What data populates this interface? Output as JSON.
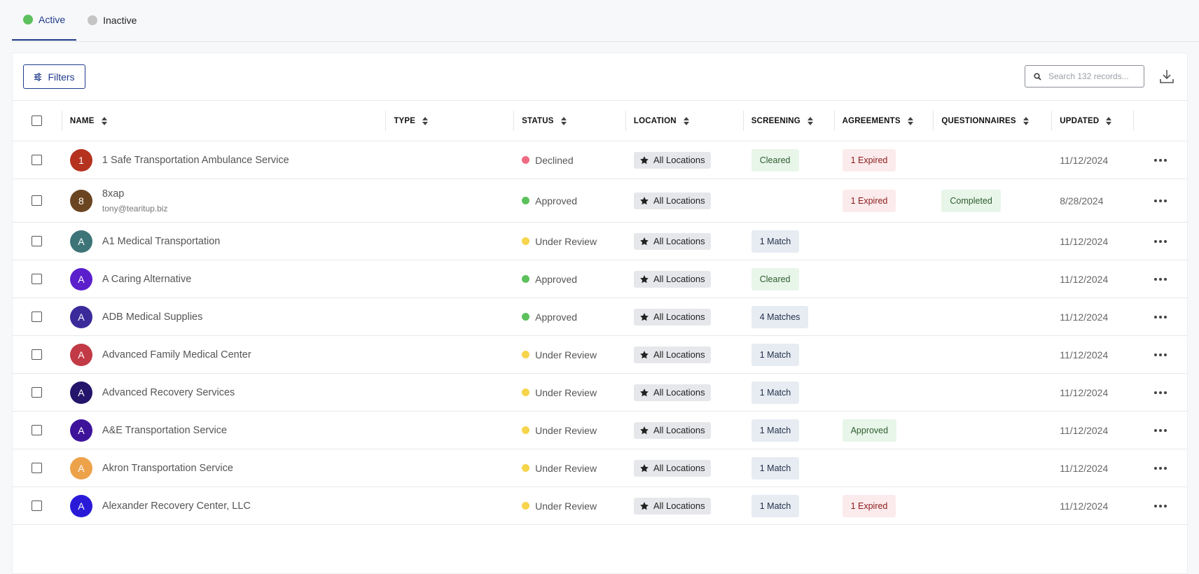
{
  "tabs": [
    {
      "label": "Active",
      "dot_color": "#5cc15c"
    },
    {
      "label": "Inactive",
      "dot_color": "#c4c4c4"
    }
  ],
  "toolbar": {
    "filters_label": "Filters",
    "search_placeholder": "Search 132 records..."
  },
  "columns": [
    "NAME",
    "TYPE",
    "STATUS",
    "LOCATION",
    "SCREENING",
    "AGREEMENTS",
    "QUESTIONNAIRES",
    "UPDATED"
  ],
  "status_colors": {
    "Declined": "#ef6b84",
    "Approved": "#5cc15c",
    "Under Review": "#f6d44c"
  },
  "rows": [
    {
      "initial": "1",
      "avatar_color": "#b5321f",
      "name": "1 Safe Transportation Ambulance Service",
      "email": "",
      "type": "",
      "status": "Declined",
      "location": "All Locations",
      "screening": "Cleared",
      "agreements": "1 Expired",
      "questionnaires": "",
      "updated": "11/12/2024"
    },
    {
      "initial": "8",
      "avatar_color": "#6b4522",
      "name": "8xap",
      "email": "tony@tearitup.biz",
      "type": "",
      "status": "Approved",
      "location": "All Locations",
      "screening": "",
      "agreements": "1 Expired",
      "questionnaires": "Completed",
      "updated": "8/28/2024"
    },
    {
      "initial": "A",
      "avatar_color": "#3d7478",
      "name": "A1 Medical Transportation",
      "email": "",
      "type": "",
      "status": "Under Review",
      "location": "All Locations",
      "screening": "1 Match",
      "agreements": "",
      "questionnaires": "",
      "updated": "11/12/2024"
    },
    {
      "initial": "A",
      "avatar_color": "#5b1fcc",
      "name": "A Caring Alternative",
      "email": "",
      "type": "",
      "status": "Approved",
      "location": "All Locations",
      "screening": "Cleared",
      "agreements": "",
      "questionnaires": "",
      "updated": "11/12/2024"
    },
    {
      "initial": "A",
      "avatar_color": "#3a2a9a",
      "name": "ADB Medical Supplies",
      "email": "",
      "type": "",
      "status": "Approved",
      "location": "All Locations",
      "screening": "4 Matches",
      "agreements": "",
      "questionnaires": "",
      "updated": "11/12/2024"
    },
    {
      "initial": "A",
      "avatar_color": "#c23a45",
      "name": "Advanced Family Medical Center",
      "email": "",
      "type": "",
      "status": "Under Review",
      "location": "All Locations",
      "screening": "1 Match",
      "agreements": "",
      "questionnaires": "",
      "updated": "11/12/2024"
    },
    {
      "initial": "A",
      "avatar_color": "#24146a",
      "name": "Advanced Recovery Services",
      "email": "",
      "type": "",
      "status": "Under Review",
      "location": "All Locations",
      "screening": "1 Match",
      "agreements": "",
      "questionnaires": "",
      "updated": "11/12/2024"
    },
    {
      "initial": "A",
      "avatar_color": "#3d139a",
      "name": "A&E Transportation Service",
      "email": "",
      "type": "",
      "status": "Under Review",
      "location": "All Locations",
      "screening": "1 Match",
      "agreements": "Approved",
      "questionnaires": "",
      "updated": "11/12/2024"
    },
    {
      "initial": "A",
      "avatar_color": "#eda24a",
      "name": "Akron Transportation Service",
      "email": "",
      "type": "",
      "status": "Under Review",
      "location": "All Locations",
      "screening": "1 Match",
      "agreements": "",
      "questionnaires": "",
      "updated": "11/12/2024"
    },
    {
      "initial": "A",
      "avatar_color": "#2a1ad8",
      "name": "Alexander Recovery Center, LLC",
      "email": "",
      "type": "",
      "status": "Under Review",
      "location": "All Locations",
      "screening": "1 Match",
      "agreements": "1 Expired",
      "questionnaires": "",
      "updated": "11/12/2024"
    }
  ]
}
